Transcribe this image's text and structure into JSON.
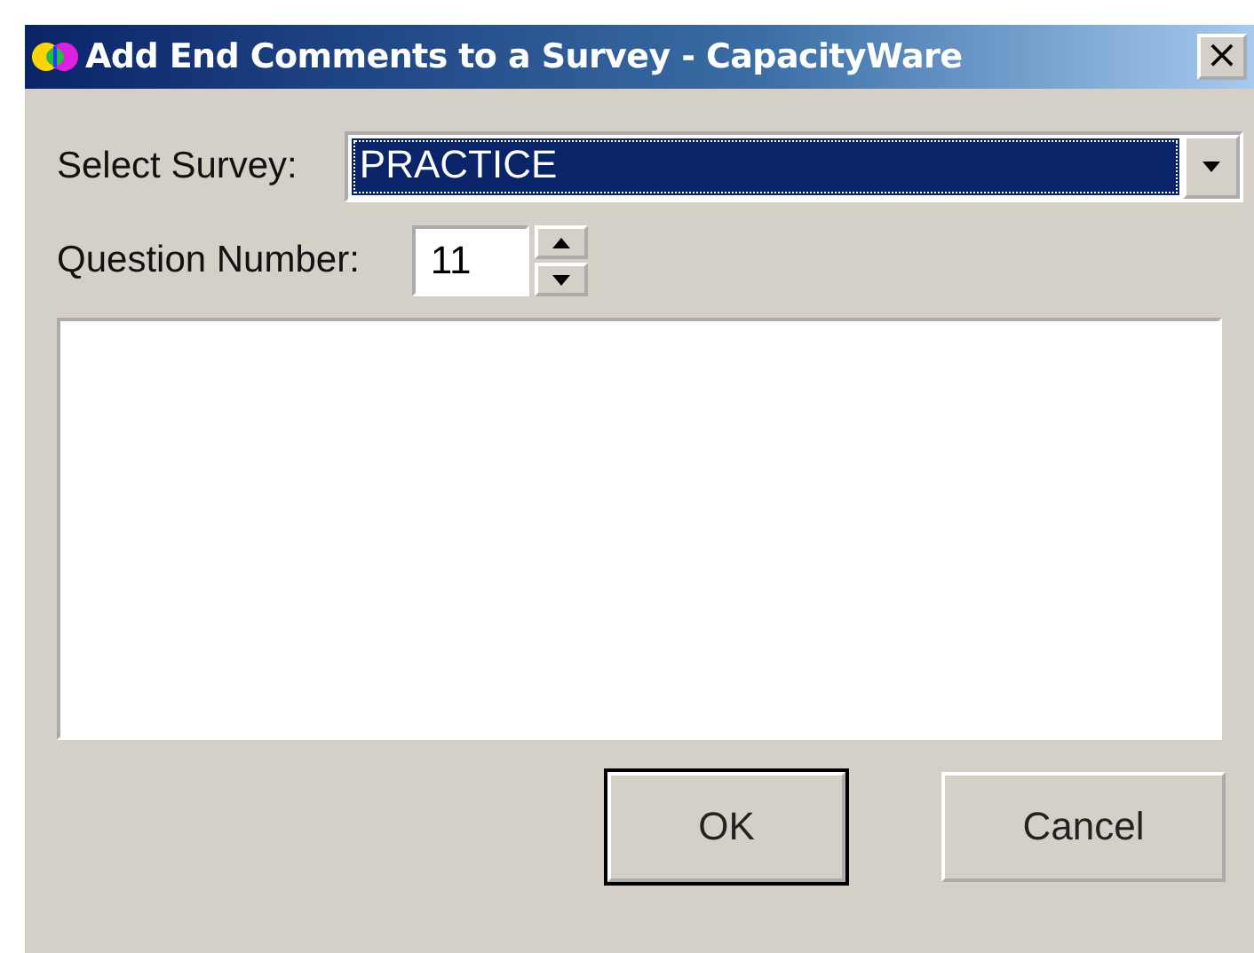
{
  "window": {
    "title": "Add End Comments to a Survey - CapacityWare",
    "close": "×"
  },
  "survey": {
    "label": "Select Survey:",
    "value": "PRACTICE"
  },
  "question": {
    "label": "Question Number:",
    "value": "11"
  },
  "buttons": [
    {
      "label": "OK",
      "default": true
    },
    {
      "label": "Cancel",
      "default": false
    }
  ]
}
